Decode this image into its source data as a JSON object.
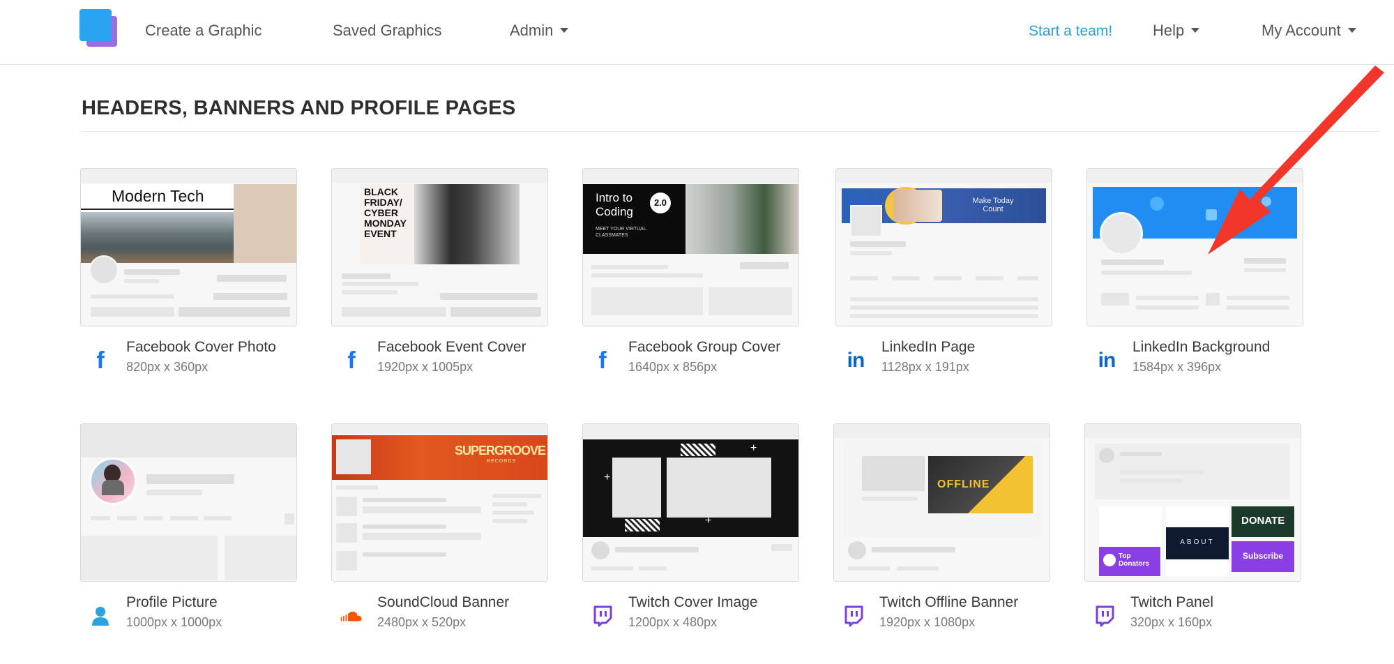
{
  "nav": {
    "create_label": "Create a Graphic",
    "saved_label": "Saved Graphics",
    "admin_label": "Admin",
    "start_team_label": "Start a team!",
    "help_label": "Help",
    "account_label": "My Account"
  },
  "section": {
    "title": "HEADERS, BANNERS AND PROFILE PAGES"
  },
  "cards": [
    {
      "name": "Facebook Cover Photo",
      "size": "820px x 360px",
      "icon": "facebook-icon",
      "thumb_text": "Modern Tech"
    },
    {
      "name": "Facebook Event Cover",
      "size": "1920px x 1005px",
      "icon": "facebook-icon",
      "thumb_text": "BLACK FRIDAY/ CYBER MONDAY EVENT"
    },
    {
      "name": "Facebook Group Cover",
      "size": "1640px x 856px",
      "icon": "facebook-icon",
      "thumb_text": "Intro to Coding",
      "thumb_badge": "2.0",
      "thumb_sub": "MEET YOUR VIRTUAL CLASSMATES"
    },
    {
      "name": "LinkedIn Page",
      "size": "1128px x 191px",
      "icon": "linkedin-icon",
      "thumb_text": "Make Today Count"
    },
    {
      "name": "LinkedIn Background",
      "size": "1584px x 396px",
      "icon": "linkedin-icon"
    },
    {
      "name": "Profile Picture",
      "size": "1000px x 1000px",
      "icon": "user-icon"
    },
    {
      "name": "SoundCloud Banner",
      "size": "2480px x 520px",
      "icon": "soundcloud-icon",
      "thumb_text": "SUPERGROOVE",
      "thumb_sub": "RECORDS"
    },
    {
      "name": "Twitch Cover Image",
      "size": "1200px x 480px",
      "icon": "twitch-icon"
    },
    {
      "name": "Twitch Offline Banner",
      "size": "1920px x 1080px",
      "icon": "twitch-icon",
      "thumb_text": "OFFLINE"
    },
    {
      "name": "Twitch Panel",
      "size": "320px x 160px",
      "icon": "twitch-icon",
      "thumb_text": "DONATE",
      "thumb_sub": "ABOUT",
      "thumb_extra": "Subscribe",
      "thumb_extra2": "Top Donators"
    }
  ],
  "colors": {
    "accent": "#29a3e0",
    "facebook": "#1877f2",
    "linkedin": "#0a66c2",
    "twitch": "#7b3fe4",
    "soundcloud": "#ff5500",
    "annotation_arrow": "#f2362a"
  }
}
